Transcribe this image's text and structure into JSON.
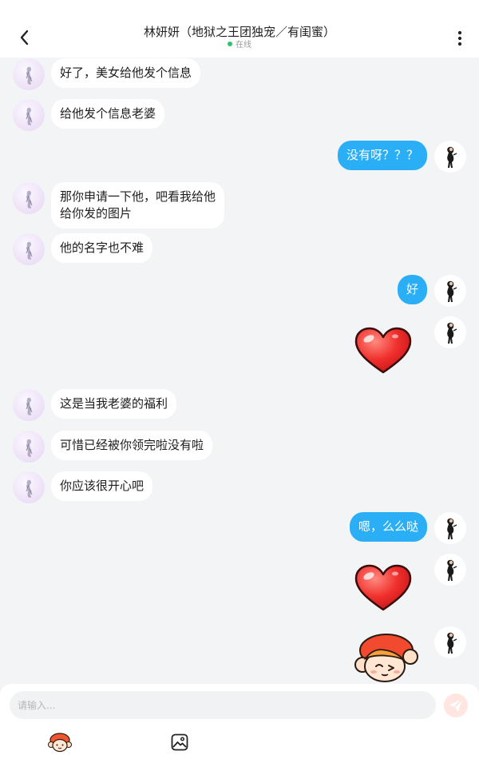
{
  "header": {
    "title": "林妍妍（地狱之王团独宠／有闺蜜）",
    "status": "在线",
    "status_color": "#2ec36b",
    "back_icon": "chevron-left-icon",
    "more_icon": "more-vertical-icon"
  },
  "messages": [
    {
      "from": "her",
      "type": "text",
      "text": "好了，美女给他发个信息"
    },
    {
      "from": "her",
      "type": "text",
      "text": "给他发个信息老婆"
    },
    {
      "from": "me",
      "type": "text",
      "text": "没有呀？？？"
    },
    {
      "from": "her",
      "type": "text",
      "lines": [
        "那你申请一下他，吧看我给他",
        "给你发的图片"
      ]
    },
    {
      "from": "her",
      "type": "text",
      "text": "他的名字也不难"
    },
    {
      "from": "me",
      "type": "text",
      "text": "好"
    },
    {
      "from": "me",
      "type": "sticker",
      "sticker": "heart-sticker"
    },
    {
      "from": "her",
      "type": "text",
      "text": "这是当我老婆的福利"
    },
    {
      "from": "her",
      "type": "text",
      "text": "可惜已经被你领完啦没有啦"
    },
    {
      "from": "her",
      "type": "text",
      "text": "你应该很开心吧"
    },
    {
      "from": "me",
      "type": "text",
      "text": "嗯，么么哒"
    },
    {
      "from": "me",
      "type": "sticker",
      "sticker": "heart-sticker"
    },
    {
      "from": "me",
      "type": "sticker",
      "sticker": "cartoon-girl-sticker"
    }
  ],
  "composer": {
    "placeholder": "请输入...",
    "send_icon": "send-icon",
    "tools": [
      "sticker-face-icon",
      "image-icon"
    ]
  },
  "colors": {
    "my_bubble": "#2aaef5",
    "her_bubble": "#ffffff",
    "background": "#f3f4f6"
  }
}
